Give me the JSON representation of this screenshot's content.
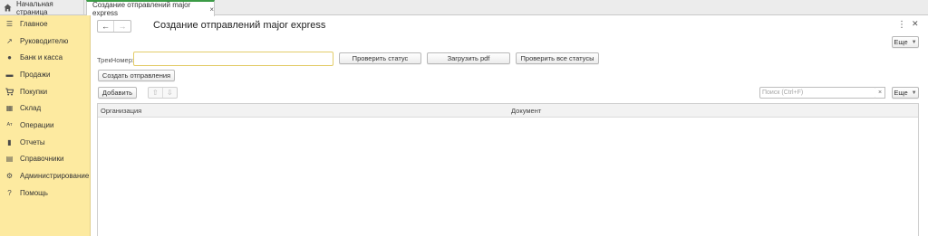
{
  "tabs": {
    "home_label": "Начальная страница",
    "active_label": "Создание отправлений major express",
    "close_glyph": "×"
  },
  "sidebar": {
    "items": [
      {
        "label": "Главное",
        "icon": "menu-icon",
        "glyph": "☰"
      },
      {
        "label": "Руководителю",
        "icon": "trend-icon",
        "glyph": "↗"
      },
      {
        "label": "Банк и касса",
        "icon": "coins-icon",
        "glyph": "●"
      },
      {
        "label": "Продажи",
        "icon": "cash-register-icon",
        "glyph": "▬"
      },
      {
        "label": "Покупки",
        "icon": "cart-icon",
        "glyph": "🛒"
      },
      {
        "label": "Склад",
        "icon": "warehouse-icon",
        "glyph": "▦"
      },
      {
        "label": "Операции",
        "icon": "operations-icon",
        "glyph": "Ат"
      },
      {
        "label": "Отчеты",
        "icon": "chart-icon",
        "glyph": "▮"
      },
      {
        "label": "Справочники",
        "icon": "book-icon",
        "glyph": "▤"
      },
      {
        "label": "Администрирование",
        "icon": "gear-icon",
        "glyph": "⚙"
      },
      {
        "label": "Помощь",
        "icon": "help-icon",
        "glyph": "?"
      }
    ]
  },
  "form": {
    "title": "Создание отправлений major express",
    "more_label": "Еще",
    "track_label": "ТрекНомер:",
    "track_value": "",
    "check_status_label": "Проверить статус",
    "load_pdf_label": "Загрузить pdf",
    "check_all_label": "Проверить все статусы",
    "create_label": "Создать отправления"
  },
  "table": {
    "add_label": "Добавить",
    "search_placeholder": "Поиск (Ctrl+F)",
    "search_clear": "×",
    "more_label": "Еще",
    "columns": [
      "Организация",
      "Документ"
    ],
    "rows": []
  }
}
